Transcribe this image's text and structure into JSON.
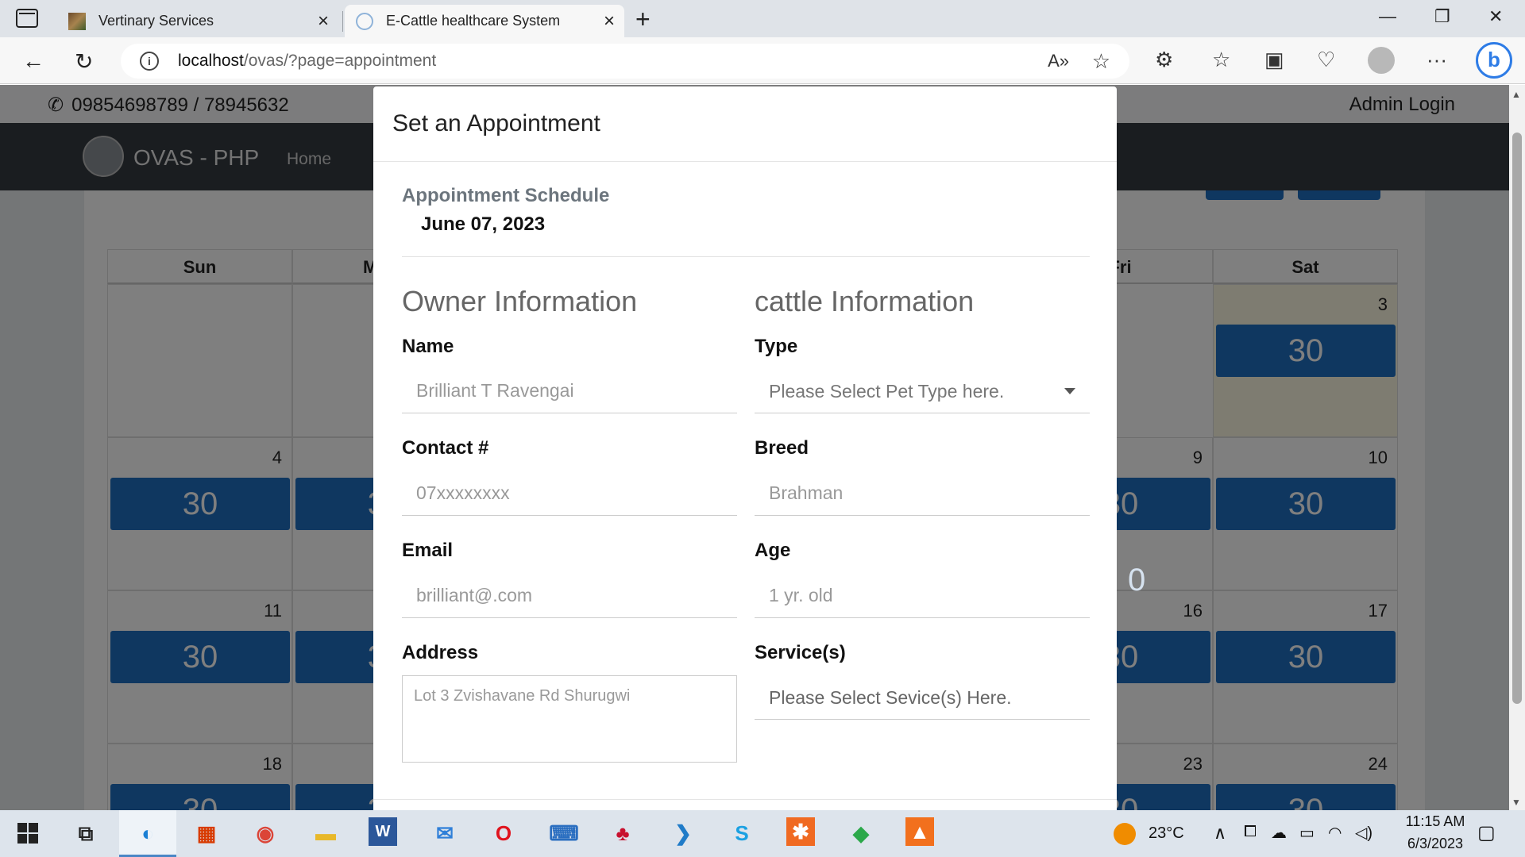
{
  "browser": {
    "tabs": [
      {
        "title": "Vertinary Services"
      },
      {
        "title": "E-Cattle healthcare System"
      }
    ],
    "url_host": "localhost",
    "url_path": "/ovas/?page=appointment"
  },
  "site": {
    "contact": "09854698789 / 78945632",
    "admin_link": "Admin Login",
    "brand": "OVAS - PHP",
    "nav": [
      "Home"
    ]
  },
  "calendar": {
    "days": [
      "Sun",
      "M",
      "Fri",
      "Sat"
    ],
    "slot_value": "30",
    "dates": [
      "3",
      "4",
      "9",
      "10",
      "11",
      "16",
      "17",
      "18",
      "23",
      "24"
    ],
    "partial_slot": "0"
  },
  "modal": {
    "title": "Set an Appointment",
    "schedule_label": "Appointment Schedule",
    "schedule_date": "June 07, 2023",
    "owner_section": "Owner Information",
    "cattle_section": "cattle Information",
    "owner": {
      "name_label": "Name",
      "name_placeholder": "Brilliant T Ravengai",
      "contact_label": "Contact #",
      "contact_placeholder": "07xxxxxxxx",
      "email_label": "Email",
      "email_placeholder": "brilliant@.com",
      "address_label": "Address",
      "address_placeholder": "Lot 3 Zvishavane Rd Shurugwi"
    },
    "cattle": {
      "type_label": "Type",
      "type_value": "Please Select Pet Type here.",
      "breed_label": "Breed",
      "breed_placeholder": "Brahman",
      "age_label": "Age",
      "age_placeholder": "1 yr. old",
      "services_label": "Service(s)",
      "services_value": "Please Select Sevice(s) Here."
    }
  },
  "taskbar": {
    "weather": "23°C",
    "time": "11:15 AM",
    "date": "6/3/2023"
  }
}
